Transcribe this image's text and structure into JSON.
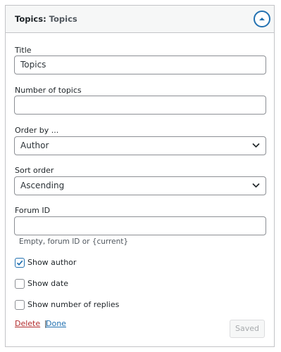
{
  "widget": {
    "name": "Topics",
    "title_separator": ":",
    "in_title": " Topics",
    "toggle_icon": "chevron-up-icon",
    "colors": {
      "accent": "#2271b1",
      "delete": "#b32d2e"
    }
  },
  "form": {
    "title_label": "Title",
    "title_value": "Topics",
    "number_label": "Number of topics",
    "number_value": "",
    "order_by_label": "Order by ...",
    "order_by_value": "Author",
    "sort_order_label": "Sort order",
    "sort_order_value": "Ascending",
    "forum_id_label": "Forum ID",
    "forum_id_value": "",
    "forum_id_hint": "Empty, forum ID or {current}",
    "checkboxes": [
      {
        "label": "Show author",
        "checked": true
      },
      {
        "label": "Show date",
        "checked": false
      },
      {
        "label": "Show number of replies",
        "checked": false
      }
    ]
  },
  "actions": {
    "delete_label": "Delete",
    "separator": "|",
    "done_label": "Done",
    "saved_label": "Saved"
  }
}
